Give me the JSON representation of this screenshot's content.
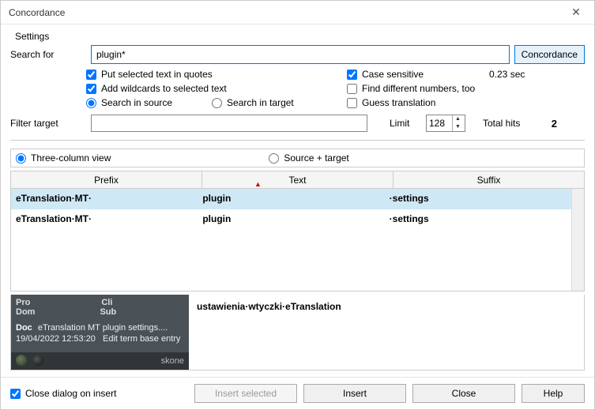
{
  "window": {
    "title": "Concordance"
  },
  "settings_label": "Settings",
  "search": {
    "label": "Search for",
    "value": "plugin*",
    "button": "Concordance"
  },
  "options": {
    "put_quotes": "Put selected text in quotes",
    "add_wildcards": "Add wildcards to selected text",
    "search_source": "Search in source",
    "search_target": "Search in target",
    "case_sensitive": "Case sensitive",
    "find_diff_numbers": "Find different numbers, too",
    "guess_translation": "Guess translation",
    "timing": "0.23 sec"
  },
  "filter": {
    "label": "Filter target",
    "limit_label": "Limit",
    "limit_value": "128",
    "total_hits_label": "Total hits",
    "total_hits_value": "2"
  },
  "view": {
    "three_col": "Three-column view",
    "source_target": "Source + target"
  },
  "columns": {
    "prefix": "Prefix",
    "text": "Text",
    "suffix": "Suffix"
  },
  "rows": [
    {
      "prefix": "eTranslation·MT·",
      "text": "plugin",
      "suffix": "·settings"
    },
    {
      "prefix": "eTranslation·MT·",
      "text": "plugin",
      "suffix": "·settings"
    }
  ],
  "detail": {
    "headers": {
      "pro": "Pro",
      "cli": "Cli",
      "dom": "Dom",
      "sub": "Sub",
      "doc": "Doc"
    },
    "doc_value": "eTranslation MT plugin settings....",
    "timestamp": "19/04/2022 12:53:20",
    "action": "Edit term base entry",
    "user": "skone",
    "translation": "ustawienia·wtyczki·eTranslation"
  },
  "footer": {
    "close_on_insert": "Close dialog on insert",
    "insert_selected": "Insert selected",
    "insert": "Insert",
    "close": "Close",
    "help": "Help"
  }
}
